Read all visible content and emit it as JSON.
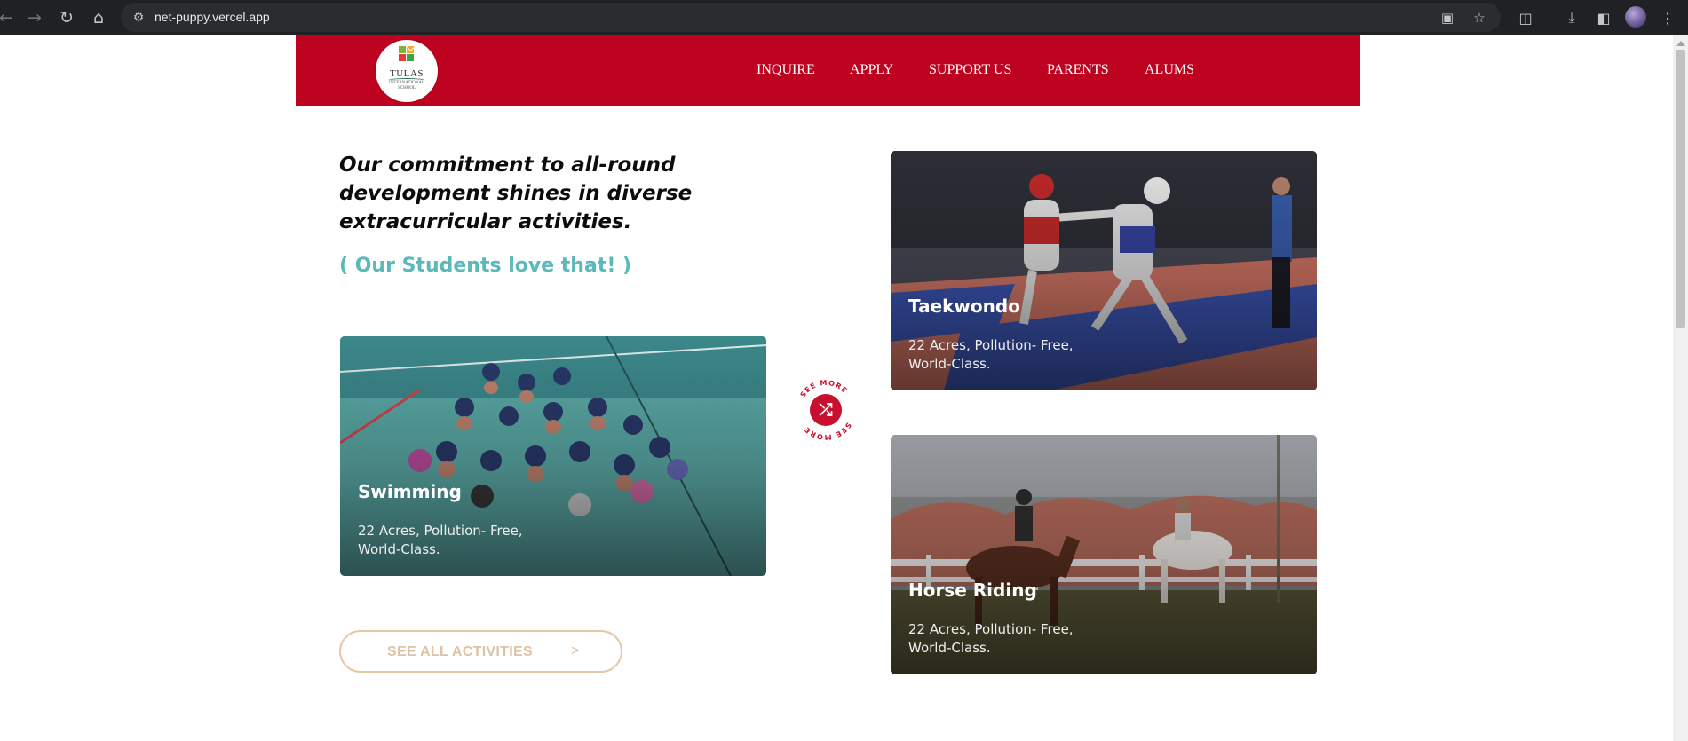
{
  "browser": {
    "url": "net-puppy.vercel.app",
    "icons": {
      "back": "arrow-left",
      "forward": "arrow-right",
      "reload": "reload",
      "home": "home",
      "site_info": "tune",
      "install": "install-app",
      "bookmark": "star",
      "extensions": "puzzle",
      "downloads": "download",
      "side_panel": "side-panel",
      "menu": "kebab"
    }
  },
  "header": {
    "logo": {
      "name": "TULAS",
      "sub_line1": "INTERNATIONAL",
      "sub_line2": "SCHOOL"
    },
    "nav": [
      "INQUIRE",
      "APPLY",
      "SUPPORT US",
      "PARENTS",
      "ALUMS"
    ],
    "brand_color": "#bd0320"
  },
  "main": {
    "headline": "Our commitment to all-round development shines in diverse extracurricular activities.",
    "subheadline": "( Our Students love that! )",
    "accent_color": "#5bb8bb",
    "cards": [
      {
        "title": "Swimming",
        "description": "22 Acres, Pollution- Free, World-Class."
      },
      {
        "title": "Taekwondo",
        "description": "22 Acres, Pollution- Free, World-Class."
      },
      {
        "title": "Horse Riding",
        "description": "22 Acres, Pollution- Free, World-Class."
      }
    ],
    "see_more": {
      "label": "SEE MORE",
      "icon": "shuffle"
    },
    "cta": {
      "label": "SEE ALL ACTIVITIES",
      "arrow": ">"
    }
  }
}
